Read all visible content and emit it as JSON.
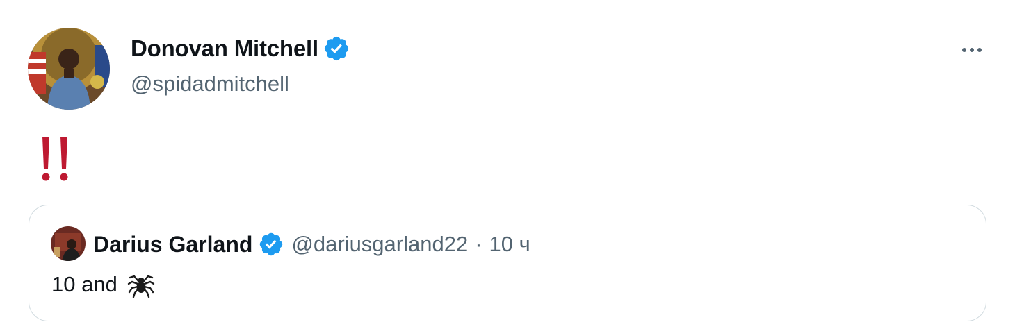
{
  "author": {
    "name": "Donovan Mitchell",
    "handle": "@spidadmitchell",
    "verified": true,
    "avatar": "avatar-photo-portrait"
  },
  "tweet": {
    "text_icon": "double-exclamation-icon",
    "text_icon_color": "#be1931"
  },
  "more_icon": "more-options-icon",
  "quoted_tweet": {
    "author_name": "Darius Garland",
    "author_handle": "@dariusgarland22",
    "verified": true,
    "separator": "·",
    "time": "10 ч",
    "text": "10 and",
    "text_icon": "spider-icon"
  },
  "colors": {
    "verified_blue": "#1d9bf0",
    "secondary_text": "#536471",
    "border": "#cfd9de",
    "primary_text": "#0f1419"
  }
}
